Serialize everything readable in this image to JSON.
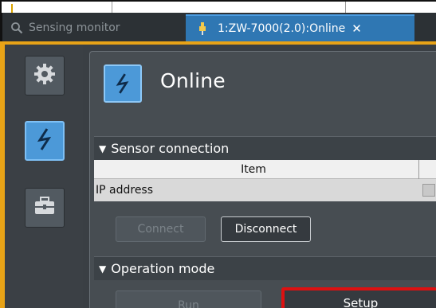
{
  "tabs": [
    {
      "label": "Sensing monitor",
      "icon": "search-icon",
      "active": false
    },
    {
      "label": "1:ZW-7000(2.0):Online",
      "icon": "sensor-icon",
      "active": true,
      "close": "✕"
    }
  ],
  "rail": {
    "items": [
      {
        "icon": "gear-icon",
        "selected": false
      },
      {
        "icon": "lightning-icon",
        "selected": true
      },
      {
        "icon": "toolbox-icon",
        "selected": false
      }
    ]
  },
  "panel": {
    "title": "Online",
    "title_icon": "lightning-icon",
    "sensor_connection": {
      "header": "Sensor connection",
      "table": {
        "column": "Item",
        "rows": [
          {
            "label": "IP address"
          }
        ]
      },
      "connect_label": "Connect",
      "disconnect_label": "Disconnect"
    },
    "operation_mode": {
      "header": "Operation mode",
      "run_label": "Run",
      "setup_label": "Setup"
    }
  },
  "colors": {
    "accent": "#4c99d8",
    "frame": "#e8a317",
    "highlight": "#dd1111"
  }
}
